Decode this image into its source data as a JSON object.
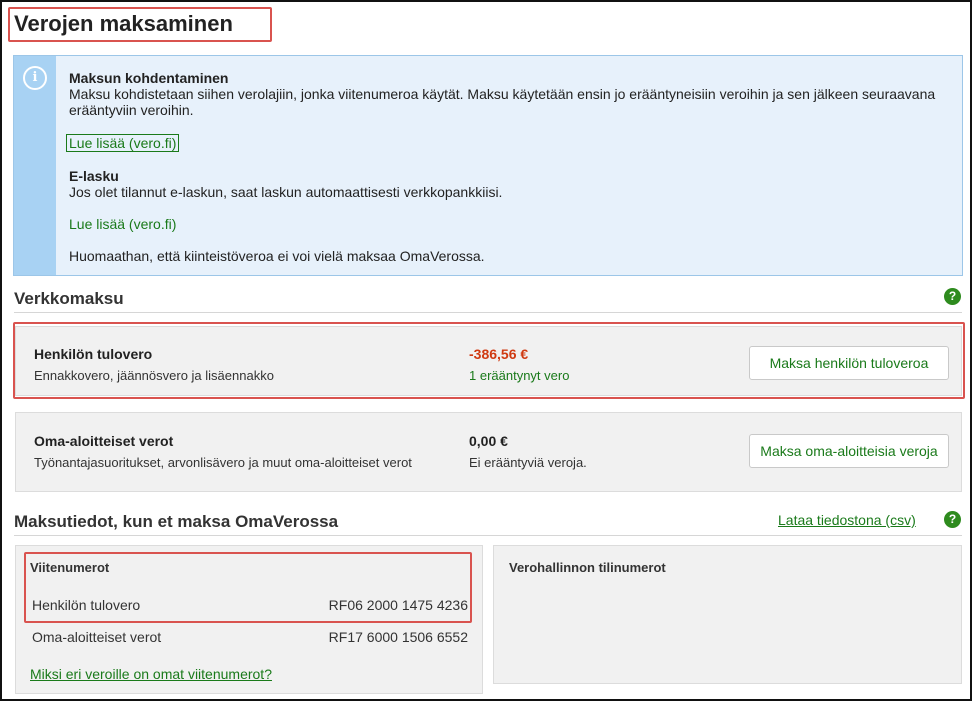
{
  "page": {
    "title": "Verojen maksaminen"
  },
  "info": {
    "allocation_heading": "Maksun kohdentaminen",
    "allocation_text": "Maksu kohdistetaan siihen verolajiin, jonka viitenumeroa käytät. Maksu käytetään ensin jo erääntyneisiin veroihin ja sen jälkeen seuraavana erääntyviin veroihin.",
    "read_more_1": "Lue lisää (vero.fi)",
    "einvoice_heading": "E-lasku",
    "einvoice_text": "Jos olet tilannut e-laskun, saat laskun automaattisesti verkkopankkiisi.",
    "read_more_2": "Lue lisää (vero.fi)",
    "note": "Huomaathan, että kiinteistöveroa ei voi vielä maksaa OmaVerossa."
  },
  "online_payment": {
    "title": "Verkkomaksu",
    "cards": [
      {
        "name": "Henkilön tulovero",
        "description": "Ennakkovero, jäännösvero ja lisäennakko",
        "amount": "-386,56 €",
        "status": "1 erääntynyt vero",
        "button": "Maksa henkilön tuloveroa"
      },
      {
        "name": "Oma-aloitteiset verot",
        "description": "Työnantajasuoritukset, arvonlisävero ja muut oma-aloitteiset verot",
        "amount": "0,00 €",
        "status": "Ei erääntyviä veroja.",
        "button": "Maksa oma-aloitteisia veroja"
      }
    ]
  },
  "payment_details": {
    "title": "Maksutiedot, kun et maksa OmaVerossa",
    "csv_link": "Lataa tiedostona (csv)",
    "references": {
      "heading": "Viitenumerot",
      "rows": [
        {
          "label": "Henkilön tulovero",
          "number": "RF06 2000 1475 4236"
        },
        {
          "label": "Oma-aloitteiset verot",
          "number": "RF17 6000 1506 6552"
        }
      ],
      "why_link": "Miksi eri veroille on omat viitenumerot?"
    },
    "accounts": {
      "heading": "Verohallinnon tilinumerot"
    }
  },
  "icons": {
    "info": "info-icon",
    "help": "help-icon"
  },
  "help_glyph": "?",
  "info_glyph": "i",
  "colors": {
    "accent_green": "#1a7a1a",
    "negative": "#d03a12",
    "highlight": "#d9534f",
    "info_bg": "#e7f1fb"
  }
}
